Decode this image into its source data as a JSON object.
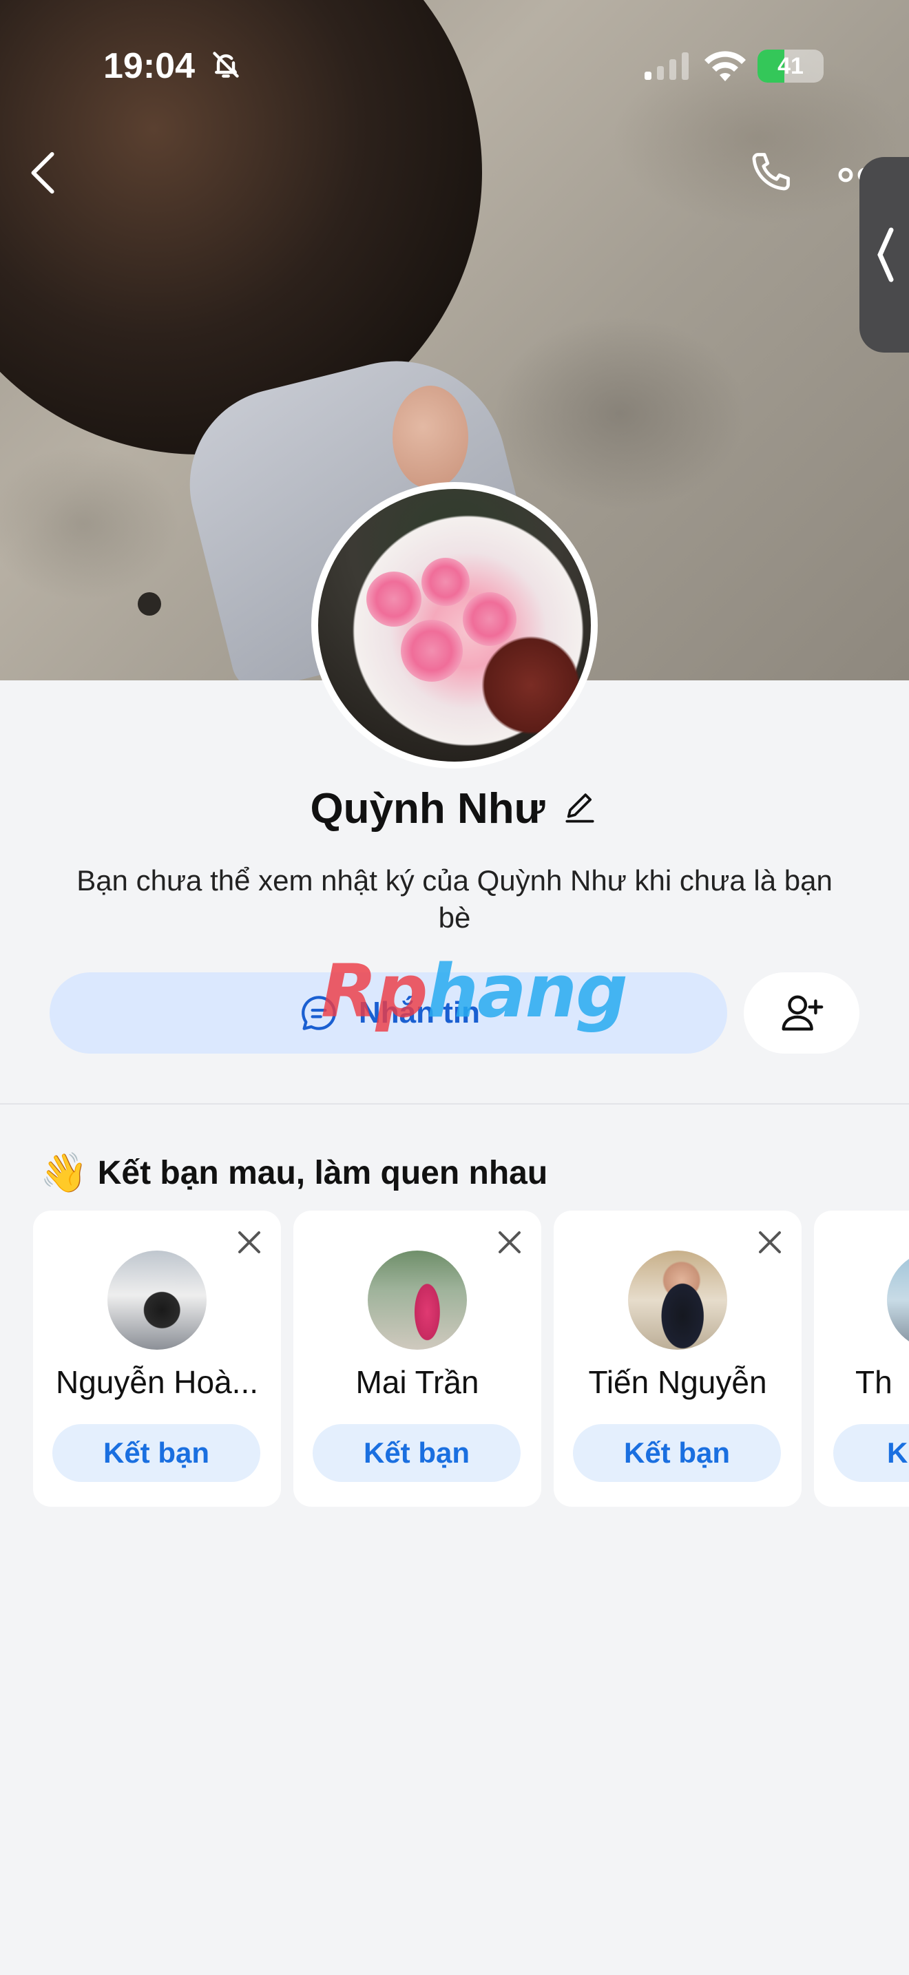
{
  "status_bar": {
    "time": "19:04",
    "battery": "41",
    "battery_color": "#34c759"
  },
  "header": {
    "back_icon": "chevron-left-icon",
    "call_icon": "phone-icon",
    "more_icon": "more-icon"
  },
  "profile": {
    "name": "Quỳnh Như",
    "diary_note": "Bạn chưa thể xem nhật ký của Quỳnh Như khi chưa là bạn bè",
    "message_button": "Nhắn tin",
    "add_friend_icon": "add-user-icon"
  },
  "watermark": {
    "part1": "Rp",
    "part2": "hang"
  },
  "suggestions": {
    "title": "Kết bạn mau, làm quen nhau",
    "emoji": "👋",
    "items": [
      {
        "name": "Nguyễn Hoà...",
        "action": "Kết bạn"
      },
      {
        "name": "Mai Trần",
        "action": "Kết bạn"
      },
      {
        "name": "Tiến Nguyễn",
        "action": "Kết bạn"
      },
      {
        "name": "Th",
        "action": "Kế"
      }
    ]
  },
  "colors": {
    "accent": "#1a6fe0",
    "accent_bg": "#dbe8fe",
    "page_bg": "#f3f4f6"
  }
}
